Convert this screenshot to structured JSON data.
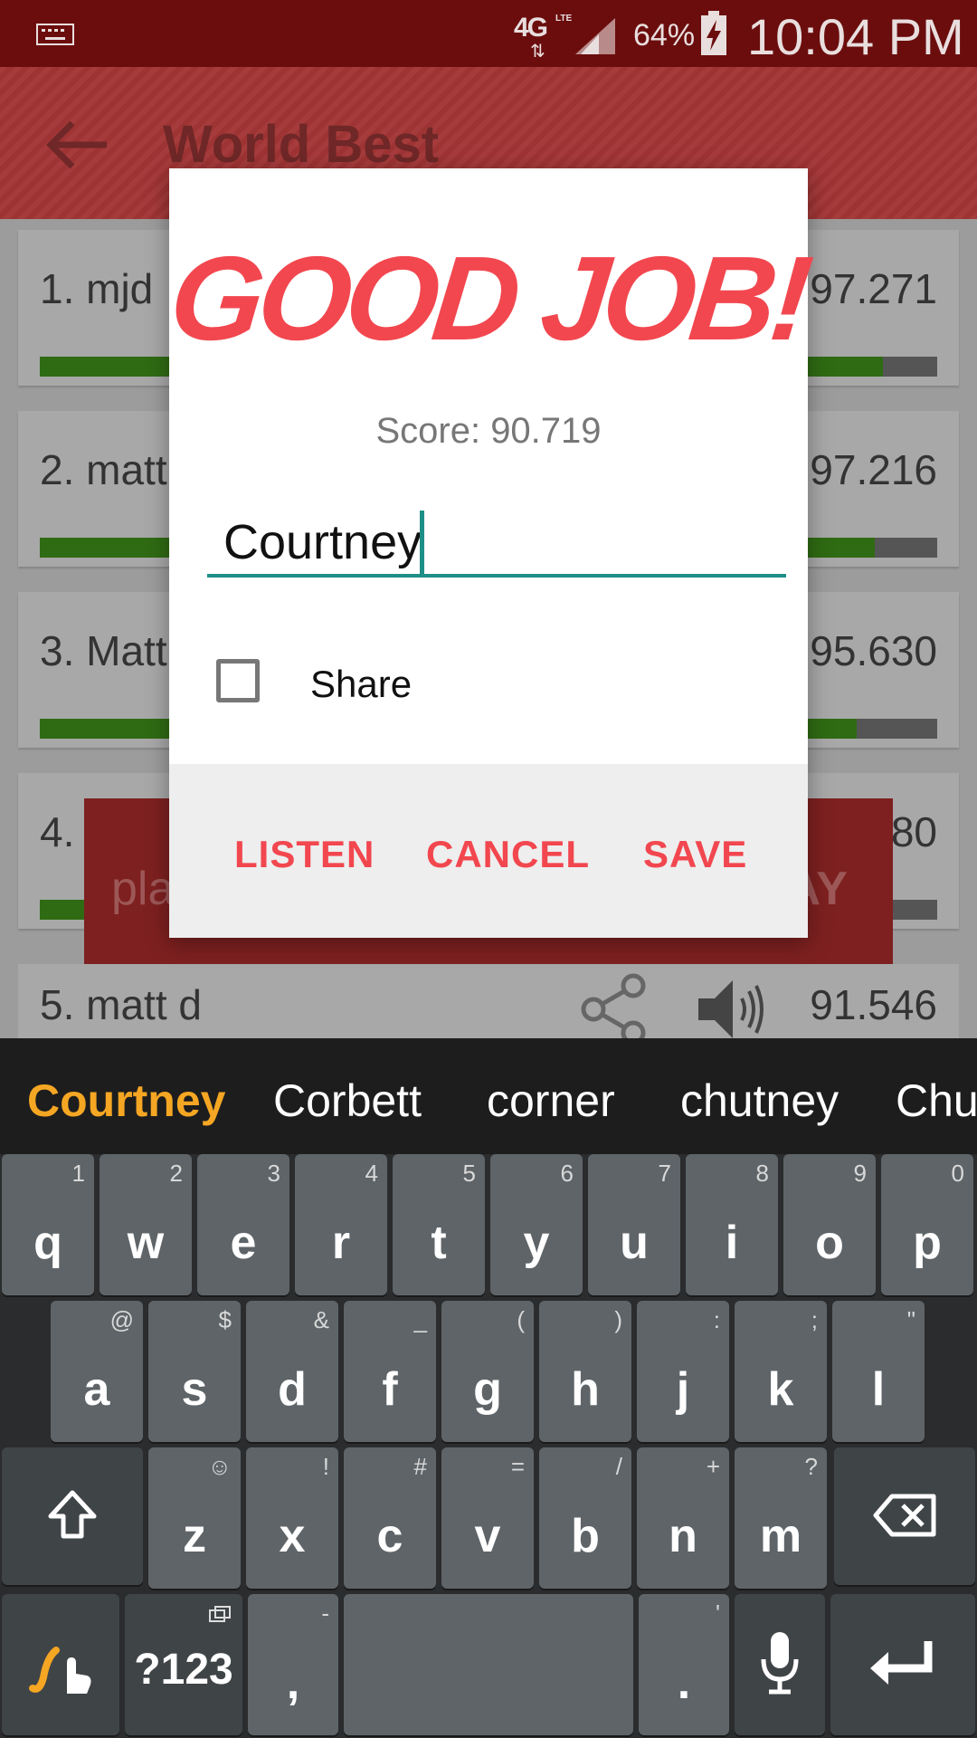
{
  "status_bar": {
    "network": "4G",
    "network_sub": "LTE",
    "battery_percent": "64%",
    "time": "10:04 PM"
  },
  "app_bar": {
    "title": "World Best"
  },
  "leaderboard": [
    {
      "rank_name": "1. mjd",
      "score": "97.271",
      "fill": 0.94
    },
    {
      "rank_name": "2. matt",
      "score": "97.216",
      "fill": 0.93
    },
    {
      "rank_name": "3. Matt",
      "score": "95.630",
      "fill": 0.91
    },
    {
      "rank_name": "4.",
      "score": "80",
      "fill": 0.2
    }
  ],
  "row5": {
    "rank_name": "5. matt d",
    "score": "91.546"
  },
  "play_banner": {
    "left_text": "pla",
    "right_text": "AY"
  },
  "dialog": {
    "headline": "GOOD JOB!",
    "score_text": "Score:  90.719",
    "name_value": "Courtney",
    "share_label": "Share",
    "buttons": {
      "listen": "LISTEN",
      "cancel": "CANCEL",
      "save": "SAVE"
    }
  },
  "keyboard": {
    "suggestions": [
      "Courtney",
      "Corbett",
      "corner",
      "chutney",
      "Chu"
    ],
    "row1": [
      {
        "k": "q",
        "h": "1"
      },
      {
        "k": "w",
        "h": "2"
      },
      {
        "k": "e",
        "h": "3"
      },
      {
        "k": "r",
        "h": "4"
      },
      {
        "k": "t",
        "h": "5"
      },
      {
        "k": "y",
        "h": "6"
      },
      {
        "k": "u",
        "h": "7"
      },
      {
        "k": "i",
        "h": "8"
      },
      {
        "k": "o",
        "h": "9"
      },
      {
        "k": "p",
        "h": "0"
      }
    ],
    "row2": [
      {
        "k": "a",
        "h": "@"
      },
      {
        "k": "s",
        "h": "$"
      },
      {
        "k": "d",
        "h": "&"
      },
      {
        "k": "f",
        "h": "_"
      },
      {
        "k": "g",
        "h": "("
      },
      {
        "k": "h",
        "h": ")"
      },
      {
        "k": "j",
        "h": ":"
      },
      {
        "k": "k",
        "h": ";"
      },
      {
        "k": "l",
        "h": "\""
      }
    ],
    "row3": [
      {
        "k": "z",
        "h": "☺"
      },
      {
        "k": "x",
        "h": "!"
      },
      {
        "k": "c",
        "h": "#"
      },
      {
        "k": "v",
        "h": "="
      },
      {
        "k": "b",
        "h": "/"
      },
      {
        "k": "n",
        "h": "+"
      },
      {
        "k": "m",
        "h": "?"
      }
    ],
    "symbols_label": "?123",
    "comma": ",",
    "comma_hint": "-",
    "period": ".",
    "period_hint": "'"
  },
  "icons": {
    "back": "arrow-left-icon",
    "share": "share-icon",
    "speaker": "speaker-icon",
    "shift": "shift-icon",
    "backspace": "backspace-icon",
    "mic": "mic-icon",
    "enter": "enter-icon",
    "swype": "swype-icon"
  },
  "colors": {
    "accent": "#f2474f",
    "status_bar": "#6b0d0d",
    "input_underline": "#1e8f86",
    "suggestion_primary": "#f5a623"
  }
}
